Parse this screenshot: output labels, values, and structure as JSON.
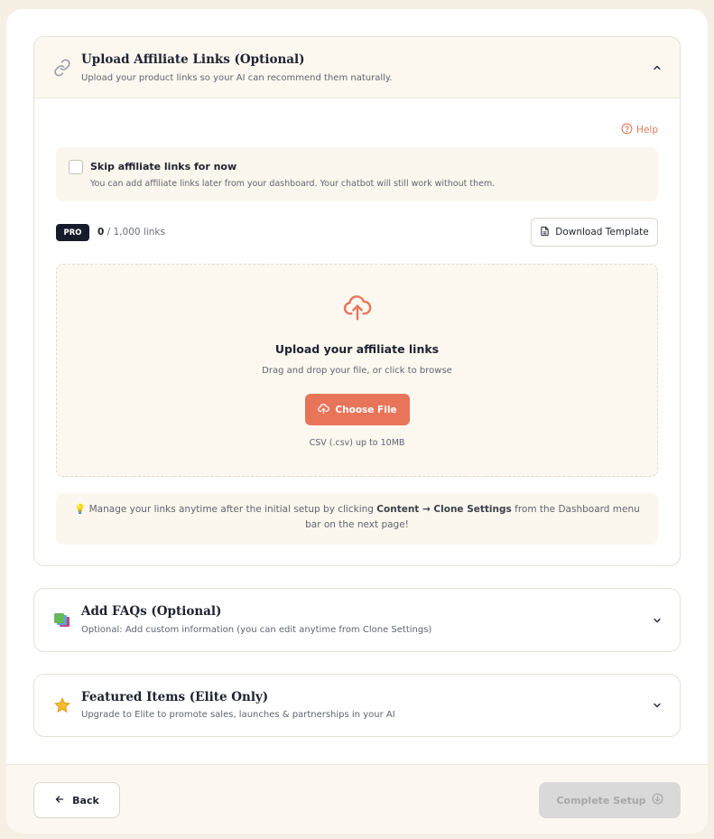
{
  "affiliate": {
    "title": "Upload Affiliate Links (Optional)",
    "subtitle": "Upload your product links so your AI can recommend them naturally.",
    "help_label": "Help",
    "skip_title": "Skip affiliate links for now",
    "skip_subtitle": "You can add affiliate links later from your dashboard. Your chatbot will still work without them.",
    "skip_checked": false,
    "plan_badge": "PRO",
    "links_used": "0",
    "links_limit": "/ 1,000 links",
    "download_template_label": "Download Template",
    "dropzone_title": "Upload your affiliate links",
    "dropzone_subtitle": "Drag and drop your file, or click to browse",
    "choose_file_label": "Choose File",
    "file_note": "CSV (.csv) up to 10MB",
    "tip_prefix": "Manage your links anytime after the initial setup by clicking",
    "tip_path": "Content → Clone Settings",
    "tip_suffix": "from the Dashboard menu bar on the next page!"
  },
  "faqs": {
    "title": "Add FAQs (Optional)",
    "subtitle": "Optional: Add custom information (you can edit anytime from Clone Settings)"
  },
  "featured": {
    "title": "Featured Items (Elite Only)",
    "subtitle": "Upgrade to Elite to promote sales, launches & partnerships in your AI"
  },
  "footer": {
    "back_label": "Back",
    "complete_label": "Complete Setup",
    "complete_disabled": true
  },
  "colors": {
    "accent": "#e8745a",
    "page_bg": "#f6efe4",
    "panel_bg": "#fcf8f0",
    "badge_bg": "#161b2b"
  },
  "icons": {
    "affiliate": "link-icon",
    "help": "help-circle-icon",
    "download": "file-icon",
    "upload": "cloud-upload-icon",
    "tip": "lightbulb-icon",
    "faqs": "stacked-cards-icon",
    "featured": "star-icon",
    "back": "arrow-left-icon",
    "complete": "arrow-down-circle-icon"
  }
}
